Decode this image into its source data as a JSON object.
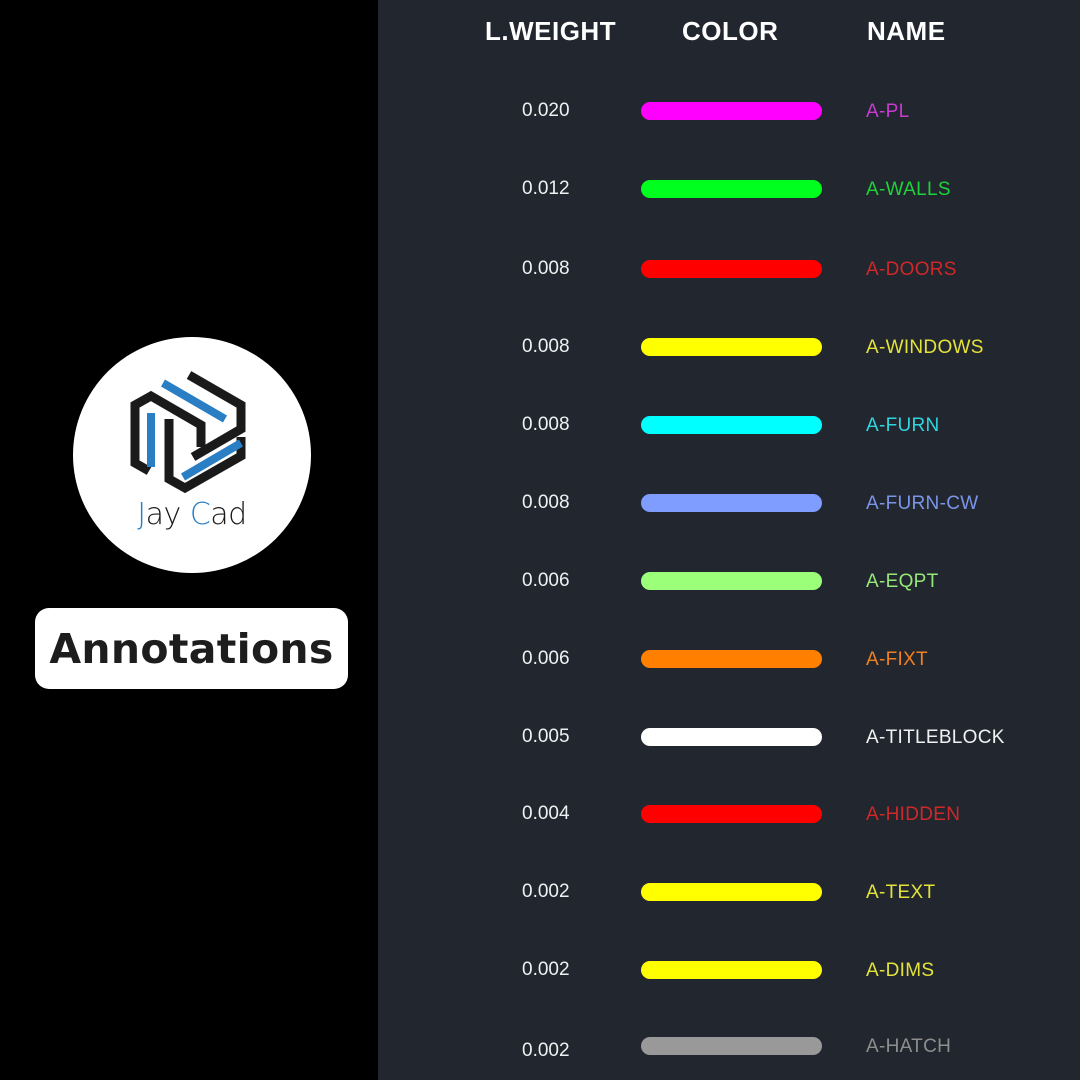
{
  "brand": {
    "logo_text_first_initial": "J",
    "logo_text_first_rest": "ay ",
    "logo_text_second_initial": "C",
    "logo_text_second_rest": "ad",
    "colors": {
      "blue": "#2a7fc4",
      "dark": "#1a1a1a"
    }
  },
  "page_title": "Annotations",
  "table": {
    "headers": {
      "weight": "L.WEIGHT",
      "color": "COLOR",
      "name": "NAME"
    },
    "rows": [
      {
        "weight": "0.020",
        "name": "A-PL",
        "bar_color": "#ff00ff",
        "text_color": "#c83ad0"
      },
      {
        "weight": "0.012",
        "name": "A-WALLS",
        "bar_color": "#00ff1e",
        "text_color": "#1ed33a"
      },
      {
        "weight": "0.008",
        "name": "A-DOORS",
        "bar_color": "#ff0000",
        "text_color": "#d02828"
      },
      {
        "weight": "0.008",
        "name": "A-WINDOWS",
        "bar_color": "#ffff00",
        "text_color": "#e3e33a"
      },
      {
        "weight": "0.008",
        "name": "A-FURN",
        "bar_color": "#00ffff",
        "text_color": "#2ed6df"
      },
      {
        "weight": "0.008",
        "name": "A-FURN-CW",
        "bar_color": "#7f9cff",
        "text_color": "#7b95e8"
      },
      {
        "weight": "0.006",
        "name": "A-EQPT",
        "bar_color": "#9cff7a",
        "text_color": "#95e879"
      },
      {
        "weight": "0.006",
        "name": "A-FIXT",
        "bar_color": "#ff7f00",
        "text_color": "#f08020"
      },
      {
        "weight": "0.005",
        "name": "A-TITLEBLOCK",
        "bar_color": "#ffffff",
        "text_color": "#f2f2f2"
      },
      {
        "weight": "0.004",
        "name": "A-HIDDEN",
        "bar_color": "#ff0000",
        "text_color": "#d02828"
      },
      {
        "weight": "0.002",
        "name": "A-TEXT",
        "bar_color": "#ffff00",
        "text_color": "#e3e33a"
      },
      {
        "weight": "0.002",
        "name": "A-DIMS",
        "bar_color": "#ffff00",
        "text_color": "#e3e33a"
      },
      {
        "weight": "0.002",
        "name": "A-HATCH",
        "bar_color": "#999999",
        "text_color": "#8e8e8e"
      }
    ]
  }
}
